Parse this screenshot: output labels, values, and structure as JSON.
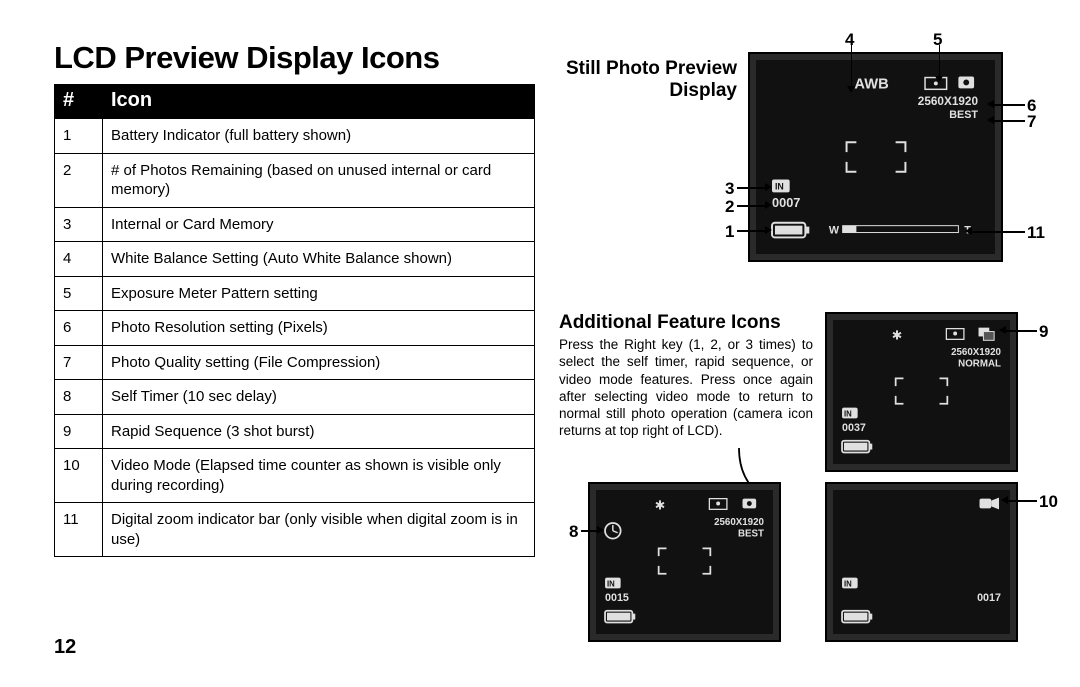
{
  "page_title": "LCD Preview Display Icons",
  "table": {
    "head_num": "#",
    "head_icon": "Icon",
    "rows": [
      {
        "n": "1",
        "d": "Battery Indicator (full battery shown)"
      },
      {
        "n": "2",
        "d": "# of Photos Remaining (based on unused internal or card memory)"
      },
      {
        "n": "3",
        "d": "Internal or Card Memory"
      },
      {
        "n": "4",
        "d": "White Balance Setting (Auto White Balance shown)"
      },
      {
        "n": "5",
        "d": "Exposure Meter Pattern setting"
      },
      {
        "n": "6",
        "d": "Photo Resolution setting (Pixels)"
      },
      {
        "n": "7",
        "d": "Photo Quality setting (File Compression)"
      },
      {
        "n": "8",
        "d": "Self Timer (10 sec delay)"
      },
      {
        "n": "9",
        "d": "Rapid Sequence (3 shot burst)"
      },
      {
        "n": "10",
        "d": "Video Mode (Elapsed time counter as shown is visible only during recording)"
      },
      {
        "n": "11",
        "d": "Digital zoom indicator bar (only visible when digital zoom is in use)"
      }
    ]
  },
  "preview_label": "Still Photo Preview Display",
  "additional_title": "Additional Feature Icons",
  "additional_body": "Press the Right key (1, 2, or 3 times) to select the self timer, rapid sequence, or video mode features. Press once again after selecting video mode to return to normal still photo operation (camera icon returns at top right of LCD).",
  "page_num": "12",
  "callouts": {
    "c1": "1",
    "c2": "2",
    "c3": "3",
    "c4": "4",
    "c5": "5",
    "c6": "6",
    "c7": "7",
    "c8": "8",
    "c9": "9",
    "c10": "10",
    "c11": "11"
  },
  "lcd_main": {
    "awb": "AWB",
    "resolution": "2560X1920",
    "quality": "BEST",
    "counter": "0007",
    "zoom_w": "W",
    "zoom_t": "T"
  },
  "lcd_a": {
    "resolution": "2560X1920",
    "quality": "NORMAL",
    "counter": "0037"
  },
  "lcd_b": {
    "resolution": "2560X1920",
    "quality": "BEST",
    "counter": "0015"
  },
  "lcd_c": {
    "counter": "0017"
  }
}
